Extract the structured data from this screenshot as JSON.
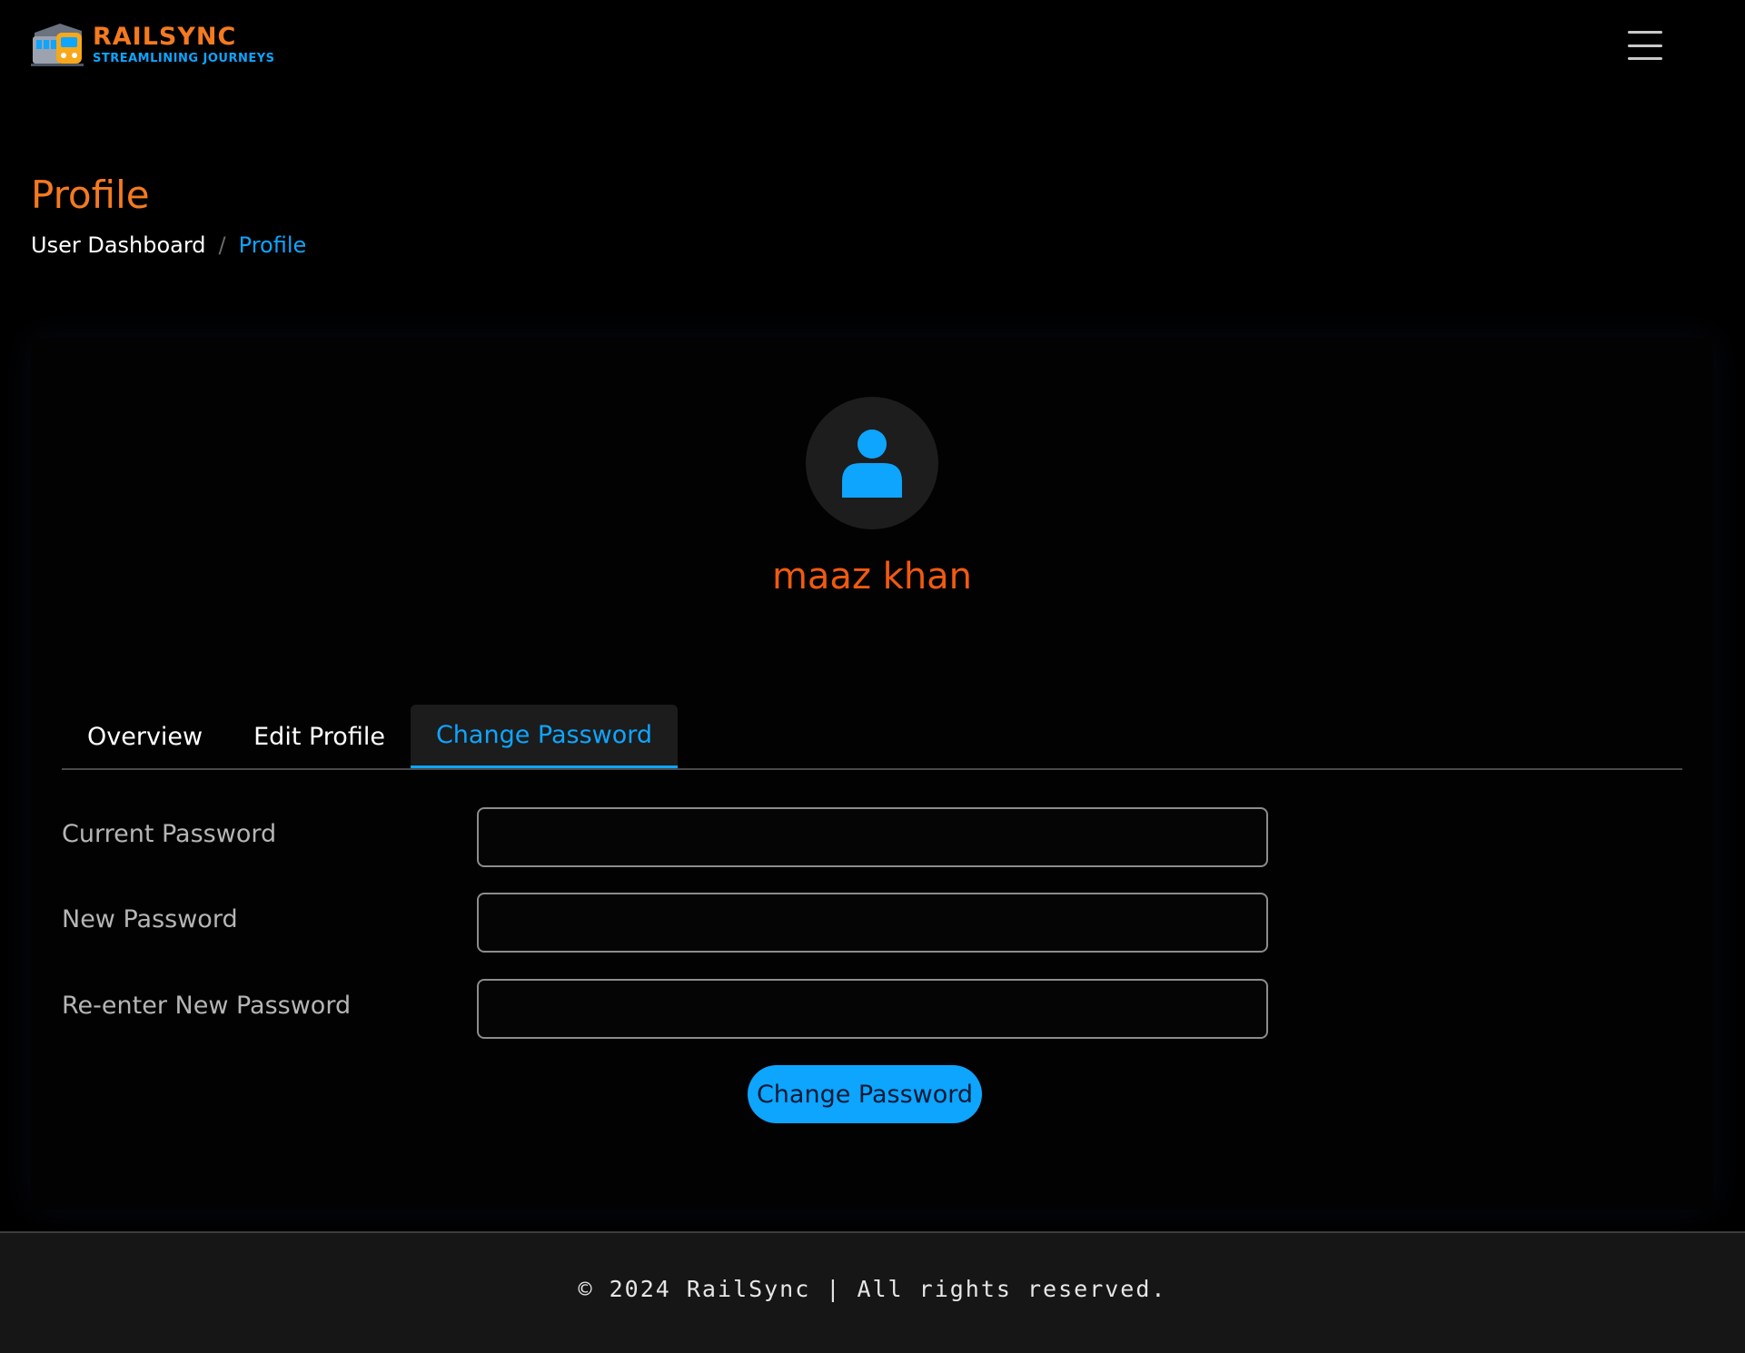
{
  "brand": {
    "name": "RAILSYNC",
    "tagline": "STREAMLINING JOURNEYS",
    "logo_icon": "train-icon",
    "primary_color": "#f47a20",
    "accent_color": "#0ea5ff"
  },
  "header": {
    "menu_icon": "hamburger-menu-icon"
  },
  "page": {
    "title": "Profile",
    "breadcrumb": {
      "home": "User Dashboard",
      "separator": "/",
      "current": "Profile"
    }
  },
  "profile": {
    "avatar_icon": "user-icon",
    "name": "maaz khan"
  },
  "tabs": [
    {
      "label": "Overview",
      "active": false
    },
    {
      "label": "Edit Profile",
      "active": false
    },
    {
      "label": "Change Password",
      "active": true
    }
  ],
  "form": {
    "current_password": {
      "label": "Current Password",
      "value": ""
    },
    "new_password": {
      "label": "New Password",
      "value": ""
    },
    "confirm_password": {
      "label": "Re-enter New Password",
      "value": ""
    },
    "submit_label": "Change Password"
  },
  "footer": {
    "text": "© 2024 RailSync | All rights reserved."
  }
}
